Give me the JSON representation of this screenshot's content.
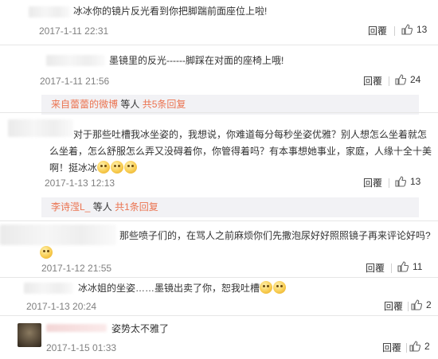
{
  "comments": [
    {
      "text": "冰冰你的镜片反光看到你把脚踹前面座位上啦!",
      "time": "2017-1-11 22:31",
      "reply": "回覆",
      "likes": "13"
    },
    {
      "text": "墨镜里的反光------脚踩在对面的座椅上哦!",
      "time": "2017-1-11 21:56",
      "reply": "回覆",
      "likes": "24",
      "sub": {
        "name": "来自蕾蕾的微博",
        "mid": "等人",
        "count": "共5条回复"
      }
    },
    {
      "text": "对于那些吐槽我冰坐姿的，我想说，你难道每分每秒坐姿优雅？别人想怎么坐着就怎么坐着，怎么舒服怎么弄又没碍着你，你管得着吗？有本事想她事业，家庭，人缘十全十美啊！挺冰冰",
      "time": "2017-1-13 12:13",
      "reply": "回覆",
      "likes": "13",
      "sub": {
        "name": "李诗滢L_",
        "mid": "等人",
        "count": "共1条回复"
      }
    },
    {
      "text": "那些喷子们的，在骂人之前麻烦你们先撒泡尿好好照照镜子再来评论好吗?",
      "time": "2017-1-12 21:55",
      "reply": "回覆",
      "likes": "11"
    },
    {
      "text": "冰冰姐的坐姿……墨镜出卖了你，恕我吐槽",
      "time": "2017-1-13 20:24",
      "reply": "回覆",
      "likes": "2"
    },
    {
      "text": "姿势太不雅了",
      "time": "2017-1-15 01:33",
      "reply": "回覆",
      "likes": "2"
    }
  ],
  "colors": {
    "accent": "#eb7350",
    "meta": "#808080",
    "sub_bg": "#f2f2f5"
  },
  "icons": {
    "like": "thumbs-up-icon",
    "emoji": "smiley-emoji-icon",
    "avatar": "user-avatar"
  }
}
